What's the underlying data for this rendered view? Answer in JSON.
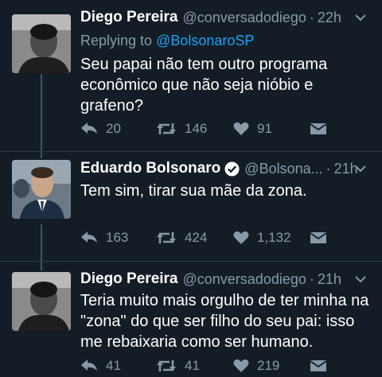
{
  "tweets": [
    {
      "name": "Diego Pereira",
      "handle": "@conversadodiego",
      "sep": "·",
      "time": "22h",
      "reply_prefix": "Replying to",
      "reply_to": "@BolsonaroSP",
      "text": "Seu papai não tem outro programa\neconômico que não seja nióbio e\ngrafeno?",
      "replies": "20",
      "retweets": "146",
      "likes": "91"
    },
    {
      "name": "Eduardo Bolsonaro",
      "handle": "@Bolsona...",
      "sep": "·",
      "time": "21h",
      "text": "Tem sim, tirar sua mãe da zona.",
      "replies": "163",
      "retweets": "424",
      "likes": "1,132"
    },
    {
      "name": "Diego Pereira",
      "handle": "@conversadodiego",
      "sep": "·",
      "time": "21h",
      "text": "Teria muito mais orgulho de ter minha na\n\"zona\" do que ser filho do seu pai: isso\nme rebaixaria como ser humano.",
      "replies": "41",
      "retweets": "41",
      "likes": "219"
    }
  ],
  "colors": {
    "background": "#141d26",
    "secondary_text": "#8899a6",
    "link": "#1da1f2",
    "thread_line": "#3d5466"
  },
  "icons": {
    "reply": "reply-icon",
    "retweet": "retweet-icon",
    "like": "heart-icon",
    "dm": "direct-message-icon",
    "menu": "chevron-down-icon",
    "verified": "verified-badge-icon"
  }
}
